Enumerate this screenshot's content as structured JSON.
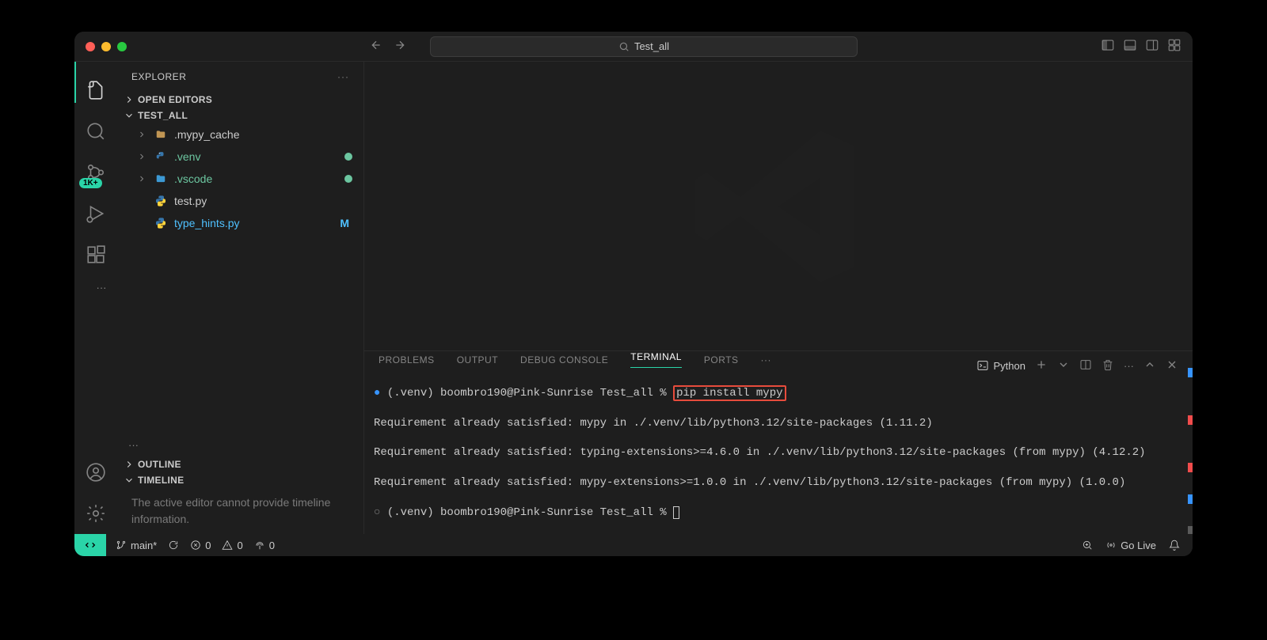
{
  "title_search": "Test_all",
  "sidebar": {
    "title": "EXPLORER",
    "openEditors": "OPEN EDITORS",
    "workspace": "TEST_ALL",
    "items": [
      {
        "label": ".mypy_cache"
      },
      {
        "label": ".venv"
      },
      {
        "label": ".vscode"
      },
      {
        "label": "test.py"
      },
      {
        "label": "type_hints.py"
      }
    ],
    "modified_marker": "M",
    "outline": "OUTLINE",
    "timeline": "TIMELINE",
    "timeline_msg": "The active editor cannot provide timeline information."
  },
  "activity_badge": "1K+",
  "panel": {
    "tabs": {
      "problems": "PROBLEMS",
      "output": "OUTPUT",
      "debug": "DEBUG CONSOLE",
      "terminal": "TERMINAL",
      "ports": "PORTS"
    },
    "profile": "Python"
  },
  "terminal": {
    "prompt1_pre": "(.venv) boombro190@Pink-Sunrise Test_all % ",
    "cmd": "pip install mypy",
    "line2": "Requirement already satisfied: mypy in ./.venv/lib/python3.12/site-packages (1.11.2)",
    "line3": "Requirement already satisfied: typing-extensions>=4.6.0 in ./.venv/lib/python3.12/site-packages (from mypy) (4.12.2)",
    "line4": "Requirement already satisfied: mypy-extensions>=1.0.0 in ./.venv/lib/python3.12/site-packages (from mypy) (1.0.0)",
    "prompt2": "(.venv) boombro190@Pink-Sunrise Test_all % "
  },
  "status": {
    "branch": "main*",
    "errors": "0",
    "warnings": "0",
    "ports": "0",
    "golive": "Go Live"
  }
}
